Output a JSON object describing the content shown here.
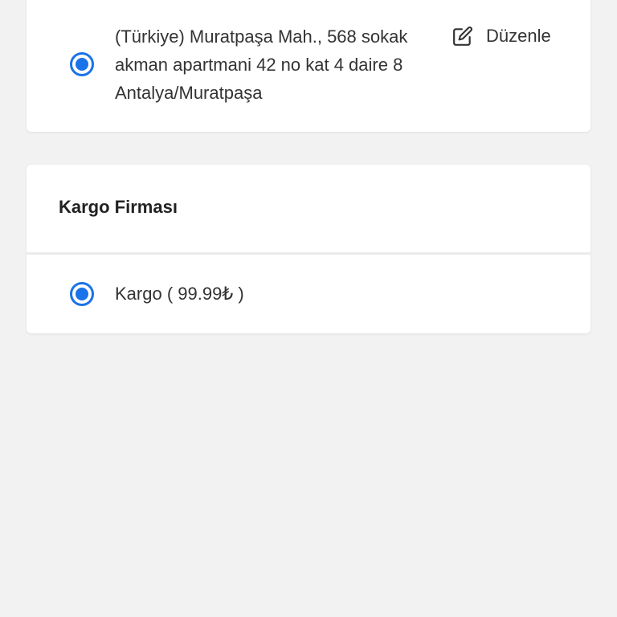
{
  "address": {
    "lines": [
      "(Türkiye) Muratpaşa Mah., 568 sokak",
      "akman apartmani 42 no kat 4 daire 8",
      "Antalya/Muratpaşa"
    ],
    "selected": true,
    "edit_label": "Düzenle",
    "edit_icon": "edit-icon"
  },
  "shipping": {
    "title": "Kargo Firması",
    "options": [
      {
        "label": "Kargo ( 99.99₺ )",
        "selected": true
      }
    ]
  },
  "colors": {
    "accent": "#1a73e8",
    "background": "#f2f2f2",
    "card": "#ffffff",
    "text": "#333333"
  }
}
